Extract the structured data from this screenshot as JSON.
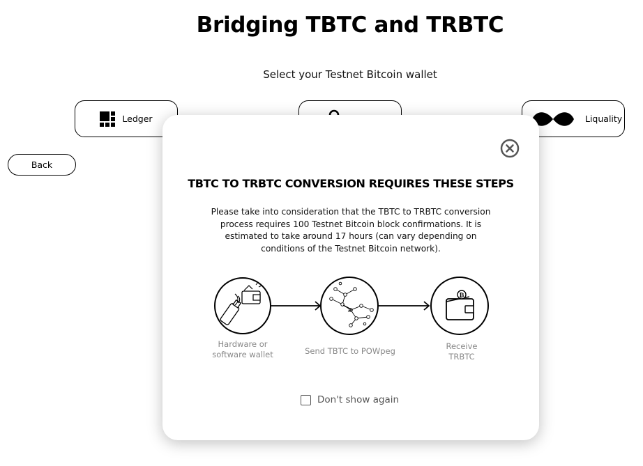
{
  "page": {
    "title": "Bridging TBTC and TRBTC",
    "subtitle": "Select your Testnet Bitcoin wallet"
  },
  "wallets": {
    "ledger_label": "Ledger",
    "liquality_label": "Liquality"
  },
  "back_label": "Back",
  "modal": {
    "heading": "TBTC TO TRBTC CONVERSION REQUIRES THESE STEPS",
    "body": "Please take into consideration that the TBTC to TRBTC conversion process requires 100 Testnet Bitcoin block confirmations. It is estimated to take around 17 hours (can vary depending on conditions of the Testnet Bitcoin network).",
    "steps": [
      {
        "label": "Hardware or software wallet",
        "icon": "wallet-device-icon"
      },
      {
        "label": "Send TBTC to POWpeg",
        "icon": "network-nodes-icon"
      },
      {
        "label": "Receive TRBTC",
        "icon": "bitcoin-wallet-icon"
      }
    ],
    "dont_show_label": "Don't show again"
  }
}
